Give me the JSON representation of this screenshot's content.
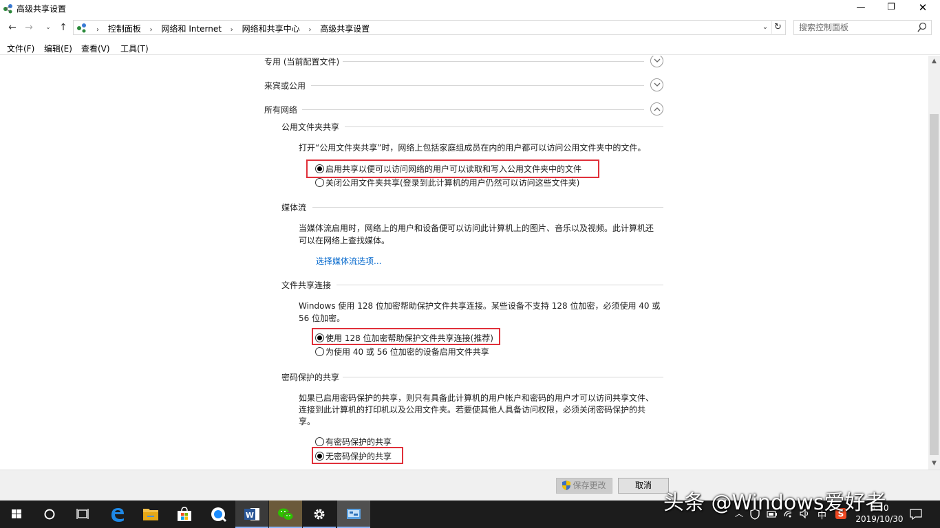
{
  "window": {
    "title": "高级共享设置",
    "minimize": "—",
    "restore": "❐",
    "close": "✕"
  },
  "nav": {
    "breadcrumbs": [
      "控制面板",
      "网络和 Internet",
      "网络和共享中心",
      "高级共享设置"
    ],
    "search_placeholder": "搜索控制面板"
  },
  "menu": [
    "文件(F)",
    "编辑(E)",
    "查看(V)",
    "工具(T)"
  ],
  "profiles": {
    "private": "专用 (当前配置文件)",
    "guest": "来宾或公用",
    "all": "所有网络"
  },
  "public_folder": {
    "heading": "公用文件夹共享",
    "desc": "打开“公用文件夹共享”时，网络上包括家庭组成员在内的用户都可以访问公用文件夹中的文件。",
    "options": [
      {
        "label": "启用共享以便可以访问网络的用户可以读取和写入公用文件夹中的文件",
        "selected": true
      },
      {
        "label": "关闭公用文件夹共享(登录到此计算机的用户仍然可以访问这些文件夹)",
        "selected": false
      }
    ]
  },
  "media": {
    "heading": "媒体流",
    "desc_line1": "当媒体流启用时，网络上的用户和设备便可以访问此计算机上的图片、音乐以及视频。此计算机还",
    "desc_line2": "可以在网络上查找媒体。",
    "link": "选择媒体流选项..."
  },
  "file_sharing": {
    "heading": "文件共享连接",
    "desc_line1": "Windows 使用 128 位加密帮助保护文件共享连接。某些设备不支持 128 位加密，必须使用 40 或",
    "desc_line2": "56 位加密。",
    "options": [
      {
        "label": "使用 128 位加密帮助保护文件共享连接(推荐)",
        "selected": true
      },
      {
        "label": "为使用 40 或 56 位加密的设备启用文件共享",
        "selected": false
      }
    ]
  },
  "password": {
    "heading": "密码保护的共享",
    "desc_line1": "如果已启用密码保护的共享，则只有具备此计算机的用户帐户和密码的用户才可以访问共享文件、",
    "desc_line2": "连接到此计算机的打印机以及公用文件夹。若要使其他人具备访问权限，必须关闭密码保护的共",
    "desc_line3": "享。",
    "options": [
      {
        "label": "有密码保护的共享",
        "selected": false
      },
      {
        "label": "无密码保护的共享",
        "selected": true
      }
    ]
  },
  "footer": {
    "save": "保存更改",
    "cancel": "取消"
  },
  "taskbar": {
    "apps": [
      "start",
      "cortana",
      "task-view",
      "edge",
      "file-explorer",
      "store",
      "qq-browser",
      "word",
      "wechat",
      "settings",
      "control-panel"
    ],
    "tray_ime": "中",
    "clock_time": "9:30",
    "clock_date": "2019/10/30"
  },
  "watermark": "头条 @Windows爱好者",
  "colors": {
    "highlight": "#e0303a",
    "link": "#0066cc",
    "taskbar": "#1c1c1c"
  }
}
